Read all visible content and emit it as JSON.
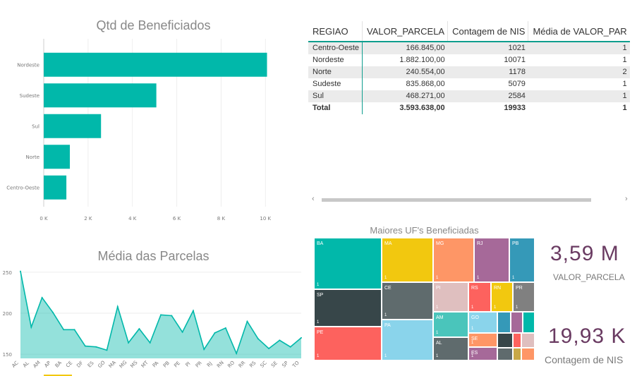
{
  "bar_title": "Qtd de Beneficiados",
  "line_title": "Média das Parcelas",
  "treemap_title": "Maiores UF's Beneficiadas",
  "table": {
    "columns": [
      "REGIAO",
      "VALOR_PARCELA",
      "Contagem de NIS",
      "Média de VALOR_PAR"
    ],
    "rows": [
      [
        "Centro-Oeste",
        "166.845,00",
        "1021",
        "1"
      ],
      [
        "Nordeste",
        "1.882.100,00",
        "10071",
        "1"
      ],
      [
        "Norte",
        "240.554,00",
        "1178",
        "2"
      ],
      [
        "Sudeste",
        "835.868,00",
        "5079",
        "1"
      ],
      [
        "Sul",
        "468.271,00",
        "2584",
        "1"
      ]
    ],
    "total": [
      "Total",
      "3.593.638,00",
      "19933",
      "1"
    ],
    "scroll_left": "‹",
    "scroll_right": "›"
  },
  "kpis": [
    {
      "value": "3,59 M",
      "label": "VALOR_PARCELA"
    },
    {
      "value": "19,93 K",
      "label": "Contagem de NIS"
    }
  ],
  "treemap": [
    {
      "label": "BA",
      "sub": "1",
      "color": "#01b8aa"
    },
    {
      "label": "SP",
      "sub": "1",
      "color": "#374649"
    },
    {
      "label": "PE",
      "sub": "1",
      "color": "#fd625e"
    },
    {
      "label": "MA",
      "sub": "1",
      "color": "#f2c80f"
    },
    {
      "label": "CE",
      "sub": "1",
      "color": "#5f6b6d"
    },
    {
      "label": "PA",
      "sub": "1",
      "color": "#8ad4eb"
    },
    {
      "label": "MG",
      "sub": "1",
      "color": "#fe9666"
    },
    {
      "label": "PI",
      "sub": "1",
      "color": "#dfbfbf"
    },
    {
      "label": "AM",
      "sub": "1",
      "color": "#4ac5bb"
    },
    {
      "label": "AL",
      "sub": "1",
      "color": "#5f6b6d"
    },
    {
      "label": "RJ",
      "sub": "1",
      "color": "#a66999"
    },
    {
      "label": "RS",
      "sub": "1",
      "color": "#fd625e"
    },
    {
      "label": "RN",
      "sub": "1",
      "color": "#f2c80f"
    },
    {
      "label": "GO",
      "sub": "1",
      "color": "#8ad4eb"
    },
    {
      "label": "SE",
      "sub": "1",
      "color": "#fe9666"
    },
    {
      "label": "ES",
      "sub": "1",
      "color": "#a66999"
    },
    {
      "label": "PB",
      "sub": "1",
      "color": "#3599b8"
    },
    {
      "label": "PR",
      "sub": "1",
      "color": "#808080"
    },
    {
      "label": "",
      "sub": "",
      "color": "#3599b8"
    },
    {
      "label": "",
      "sub": "",
      "color": "#a66999"
    },
    {
      "label": "",
      "sub": "",
      "color": "#01b8aa"
    },
    {
      "label": "",
      "sub": "",
      "color": "#374649"
    },
    {
      "label": "",
      "sub": "",
      "color": "#fd625e"
    },
    {
      "label": "",
      "sub": "",
      "color": "#dfbfbf"
    },
    {
      "label": "",
      "sub": "",
      "color": "#5f6b6d"
    },
    {
      "label": "",
      "sub": "",
      "color": "#c8a848"
    },
    {
      "label": "",
      "sub": "",
      "color": "#fe9666"
    },
    {
      "label": "",
      "sub": "",
      "color": "#f2c80f"
    },
    {
      "label": "",
      "sub": "",
      "color": "#e83c55"
    },
    {
      "label": "",
      "sub": "",
      "color": "#3599b8"
    },
    {
      "label": "",
      "sub": "",
      "color": "#b85a3c"
    }
  ],
  "chart_data": [
    {
      "type": "bar",
      "orientation": "horizontal",
      "title": "Qtd de Beneficiados",
      "categories": [
        "Nordeste",
        "Sudeste",
        "Sul",
        "Norte",
        "Centro-Oeste"
      ],
      "values": [
        10071,
        5079,
        2584,
        1178,
        1021
      ],
      "xlim": [
        0,
        10500
      ],
      "xticks": [
        "0 K",
        "2 K",
        "4 K",
        "6 K",
        "8 K",
        "10 K"
      ],
      "color": "#01b8aa",
      "grid": true
    },
    {
      "type": "area",
      "title": "Média das Parcelas",
      "categories": [
        "AC",
        "AL",
        "AM",
        "AP",
        "BA",
        "CE",
        "DF",
        "ES",
        "GO",
        "MA",
        "MG",
        "MS",
        "MT",
        "PA",
        "PB",
        "PE",
        "PI",
        "PR",
        "RJ",
        "RN",
        "RO",
        "RR",
        "RS",
        "SC",
        "SE",
        "SP",
        "TO"
      ],
      "values": [
        251,
        183,
        219,
        201,
        180,
        180,
        160,
        159,
        155,
        208,
        164,
        181,
        164,
        198,
        197,
        177,
        203,
        156,
        176,
        182,
        151,
        190,
        169,
        157,
        167,
        159,
        170
      ],
      "ylim": [
        145,
        255
      ],
      "yticks": [
        150,
        200,
        250
      ],
      "color": "#01b8aa",
      "grid": true
    }
  ]
}
